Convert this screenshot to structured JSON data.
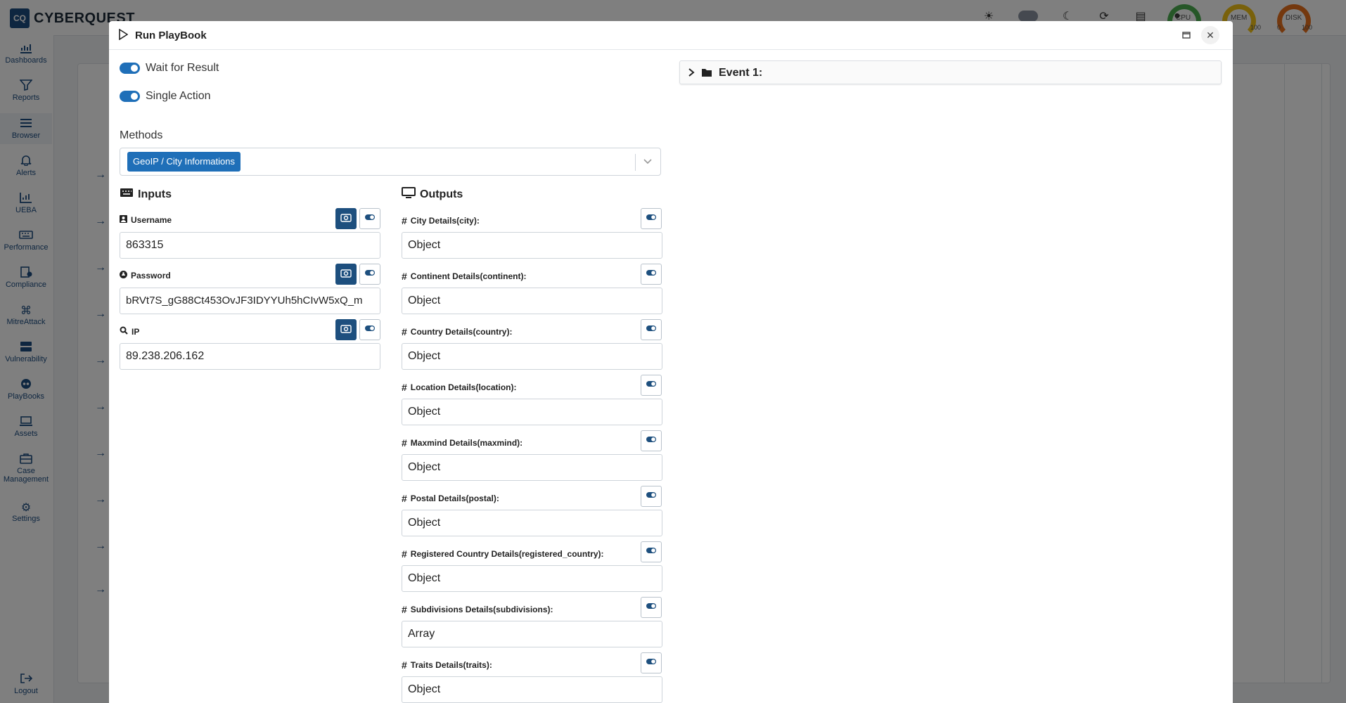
{
  "app": {
    "logo_mark": "CQ",
    "logo_text": "CYBERQUEST"
  },
  "topbar": {
    "gauges": [
      {
        "label": "CPU",
        "min": "",
        "max": "",
        "color": "#4caf50"
      },
      {
        "label": "MEM",
        "min": "",
        "max": "100",
        "color": "#f2c316"
      },
      {
        "label": "DISK",
        "min": "0",
        "max": "100",
        "color": "#e8711d"
      }
    ]
  },
  "sidebar": {
    "items": [
      {
        "label": "Dashboards",
        "icon": "dashboard-icon"
      },
      {
        "label": "Reports",
        "icon": "filter-icon"
      },
      {
        "label": "Browser",
        "icon": "list-icon"
      },
      {
        "label": "Alerts",
        "icon": "bell-icon"
      },
      {
        "label": "UEBA",
        "icon": "chart-icon"
      },
      {
        "label": "Performance",
        "icon": "keyboard-icon"
      },
      {
        "label": "Compliance",
        "icon": "compliance-icon"
      },
      {
        "label": "MitreAttack",
        "icon": "command-icon"
      },
      {
        "label": "Vulnerability",
        "icon": "server-icon"
      },
      {
        "label": "PlayBooks",
        "icon": "playbook-icon"
      },
      {
        "label": "Assets",
        "icon": "laptop-icon"
      },
      {
        "label": "Case Management",
        "icon": "briefcase-icon"
      },
      {
        "label": "Settings",
        "icon": "gear-icon"
      }
    ],
    "logout_label": "Logout"
  },
  "modal": {
    "title": "Run PlayBook",
    "toggles": [
      {
        "label": "Wait for Result",
        "on": true
      },
      {
        "label": "Single Action",
        "on": true
      }
    ],
    "methods_label": "Methods",
    "method_selected": "GeoIP / City Informations",
    "inputs_title": "Inputs",
    "inputs": [
      {
        "label": "Username",
        "icon": "user-icon",
        "value": "863315"
      },
      {
        "label": "Password",
        "icon": "lock-icon",
        "value": "bRVt7S_gG88Ct453OvJF3IDYYUh5hCIvW5xQ_m"
      },
      {
        "label": "IP",
        "icon": "search-icon",
        "value": "89.238.206.162"
      }
    ],
    "outputs_title": "Outputs",
    "outputs": [
      {
        "label": "City Details(city):",
        "value": "Object"
      },
      {
        "label": "Continent Details(continent):",
        "value": "Object"
      },
      {
        "label": "Country Details(country):",
        "value": "Object"
      },
      {
        "label": "Location Details(location):",
        "value": "Object"
      },
      {
        "label": "Maxmind Details(maxmind):",
        "value": "Object"
      },
      {
        "label": "Postal Details(postal):",
        "value": "Object"
      },
      {
        "label": "Registered Country Details(registered_country):",
        "value": "Object"
      },
      {
        "label": "Subdivisions Details(subdivisions):",
        "value": "Array"
      },
      {
        "label": "Traits Details(traits):",
        "value": "Object"
      }
    ],
    "event_title": "Event 1:"
  }
}
